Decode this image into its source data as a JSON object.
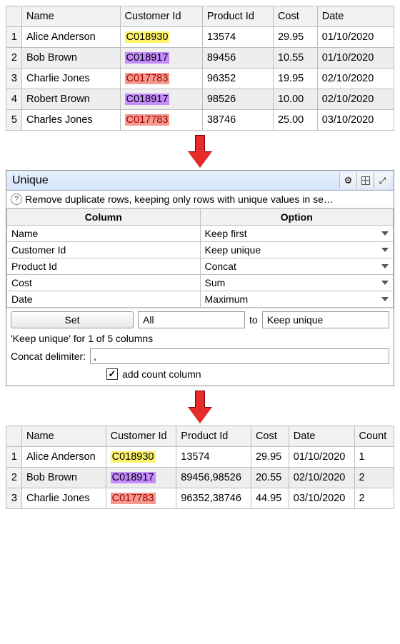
{
  "colors": {
    "hl_yellow": "#fff36c",
    "hl_purple": "#c68cff",
    "hl_red": "#f59a8f"
  },
  "table_top": {
    "headers": [
      "Name",
      "Customer Id",
      "Product Id",
      "Cost",
      "Date"
    ],
    "rows": [
      {
        "num": "1",
        "name": "Alice Anderson",
        "cust": "C018930",
        "hl": "yellow",
        "prod": "13574",
        "cost": "29.95",
        "date": "01/10/2020"
      },
      {
        "num": "2",
        "name": "Bob Brown",
        "cust": "C018917",
        "hl": "purple",
        "prod": "89456",
        "cost": "10.55",
        "date": "01/10/2020"
      },
      {
        "num": "3",
        "name": "Charlie Jones",
        "cust": "C017783",
        "hl": "red",
        "prod": "96352",
        "cost": "19.95",
        "date": "02/10/2020"
      },
      {
        "num": "4",
        "name": "Robert Brown",
        "cust": "C018917",
        "hl": "purple",
        "prod": "98526",
        "cost": "10.00",
        "date": "02/10/2020"
      },
      {
        "num": "5",
        "name": "Charles Jones",
        "cust": "C017783",
        "hl": "red",
        "prod": "38746",
        "cost": "25.00",
        "date": "03/10/2020"
      }
    ]
  },
  "panel": {
    "title": "Unique",
    "desc": "Remove duplicate rows, keeping only rows with unique values in se…",
    "header_col": "Column",
    "header_opt": "Option",
    "rows": [
      {
        "col": "Name",
        "opt": "Keep first"
      },
      {
        "col": "Customer Id",
        "opt": "Keep unique"
      },
      {
        "col": "Product Id",
        "opt": "Concat"
      },
      {
        "col": "Cost",
        "opt": "Sum"
      },
      {
        "col": "Date",
        "opt": "Maximum"
      }
    ],
    "set_label": "Set",
    "set_scope": "All",
    "to_label": "to",
    "set_value": "Keep unique",
    "status": "'Keep unique' for 1 of 5 columns",
    "delim_label": "Concat delimiter:",
    "delim_value": ",",
    "check_label": "add count column",
    "check_checked": true
  },
  "table_bottom": {
    "headers": [
      "Name",
      "Customer Id",
      "Product Id",
      "Cost",
      "Date",
      "Count"
    ],
    "rows": [
      {
        "num": "1",
        "name": "Alice Anderson",
        "cust": "C018930",
        "hl": "yellow",
        "prod": "13574",
        "cost": "29.95",
        "date": "01/10/2020",
        "count": "1"
      },
      {
        "num": "2",
        "name": "Bob Brown",
        "cust": "C018917",
        "hl": "purple",
        "prod": "89456,98526",
        "cost": "20.55",
        "date": "02/10/2020",
        "count": "2"
      },
      {
        "num": "3",
        "name": "Charlie Jones",
        "cust": "C017783",
        "hl": "red",
        "prod": "96352,38746",
        "cost": "44.95",
        "date": "03/10/2020",
        "count": "2"
      }
    ]
  }
}
